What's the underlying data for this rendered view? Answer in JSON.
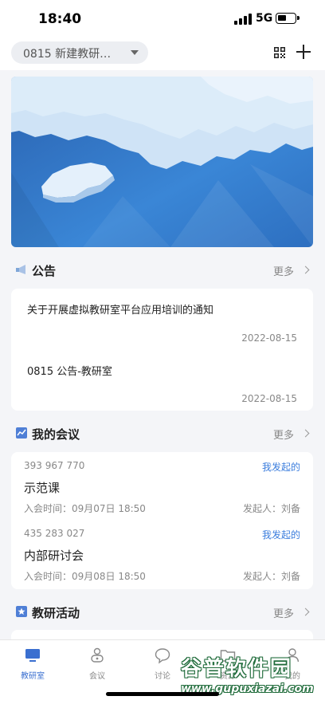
{
  "status_bar": {
    "time": "18:40",
    "network": "5G"
  },
  "top_bar": {
    "room_name": "0815 新建教研…"
  },
  "announcements": {
    "title": "公告",
    "more": "更多",
    "items": [
      {
        "title": "关于开展虚拟教研室平台应用培训的通知",
        "date": "2022-08-15"
      },
      {
        "title": "0815 公告-教研室",
        "date": "2022-08-15"
      }
    ]
  },
  "meetings": {
    "title": "我的会议",
    "more": "更多",
    "items": [
      {
        "id": "393 967 770",
        "tag": "我发起的",
        "title": "示范课",
        "time": "入会时间：09月07日 18:50",
        "host": "发起人：刘备"
      },
      {
        "id": "435 283 027",
        "tag": "我发起的",
        "title": "内部研讨会",
        "time": "入会时间：09月08日 18:50",
        "host": "发起人：刘备"
      }
    ]
  },
  "activities": {
    "title": "教研活动",
    "more": "更多"
  },
  "tabs": [
    {
      "label": "教研室",
      "icon": "monitor-icon",
      "active": true
    },
    {
      "label": "会议",
      "icon": "meeting-icon",
      "active": false
    },
    {
      "label": "讨论",
      "icon": "chat-bubble-icon",
      "active": false
    },
    {
      "label": "资源",
      "icon": "folder-icon",
      "active": false
    },
    {
      "label": "我的",
      "icon": "person-icon",
      "active": false
    }
  ],
  "watermark": {
    "main": "谷普软件园",
    "sub": "www.gupuxiazai.com"
  },
  "colors": {
    "accent": "#3a6fd0",
    "link": "#3b7ddd",
    "banner": "#2f74c6"
  }
}
